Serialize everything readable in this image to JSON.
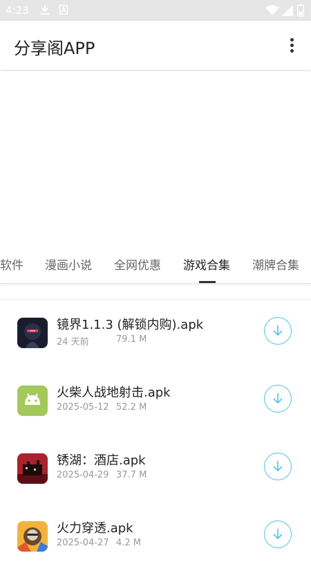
{
  "status_bar": {
    "time": "4:23",
    "icons": [
      "download-icon",
      "app-a-icon",
      "wifi-icon",
      "signal-icon",
      "battery-icon"
    ]
  },
  "app_bar": {
    "title": "分享阁APP",
    "menu_icon": "more-vert-icon"
  },
  "tabs": [
    {
      "label": "软件",
      "active": false
    },
    {
      "label": "漫画小说",
      "active": false
    },
    {
      "label": "全网优惠",
      "active": false
    },
    {
      "label": "游戏合集",
      "active": true
    },
    {
      "label": "潮牌合集",
      "active": false
    }
  ],
  "items": [
    {
      "name": "镜界1.1.3 (解锁内购).apk",
      "date": "24 天前",
      "size": "79.1 M",
      "icon": "game-cover-icon"
    },
    {
      "name": "火柴人战地射击.apk",
      "date": "2025-05-12",
      "size": "52.2 M",
      "icon": "android-icon"
    },
    {
      "name": "锈湖：酒店.apk",
      "date": "2025-04-29",
      "size": "37.7 M",
      "icon": "hotel-cover-icon"
    },
    {
      "name": "火力穿透.apk",
      "date": "2025-04-27",
      "size": "4.2 M",
      "icon": "shooter-cover-icon"
    }
  ],
  "colors": {
    "accent": "#4fc3e8",
    "status_bar": "#e6e6e6",
    "android_green": "#a4c95b"
  }
}
